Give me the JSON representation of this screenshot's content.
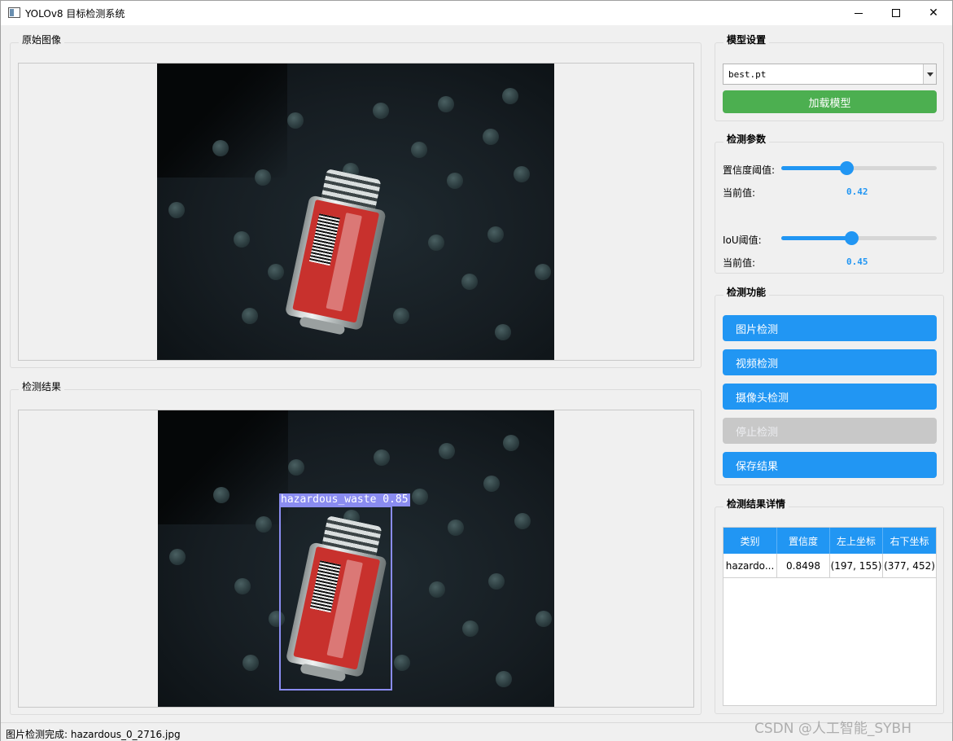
{
  "window": {
    "title": "YOLOv8 目标检测系统",
    "controls": [
      "minimize",
      "maximize",
      "close"
    ]
  },
  "original_panel": {
    "title": "原始图像"
  },
  "result_panel": {
    "title": "检测结果",
    "detection_label": "hazardous_waste 0.85"
  },
  "model_settings": {
    "title": "模型设置",
    "model_select_value": "best.pt",
    "load_button": "加载模型"
  },
  "detection_params": {
    "title": "检测参数",
    "confidence": {
      "label": "置信度阈值:",
      "current_label": "当前值:",
      "value": "0.42",
      "fraction": 0.42
    },
    "iou": {
      "label": "IoU阈值:",
      "current_label": "当前值:",
      "value": "0.45",
      "fraction": 0.45
    }
  },
  "detection_functions": {
    "title": "检测功能",
    "buttons": [
      {
        "label": "图片检测",
        "state": "enabled"
      },
      {
        "label": "视频检测",
        "state": "enabled"
      },
      {
        "label": "摄像头检测",
        "state": "enabled"
      },
      {
        "label": "停止检测",
        "state": "disabled"
      },
      {
        "label": "保存结果",
        "state": "enabled"
      }
    ]
  },
  "result_details": {
    "title": "检测结果详情",
    "columns": [
      "类别",
      "置信度",
      "左上坐标",
      "右下坐标"
    ],
    "rows": [
      [
        "hazardo...",
        "0.8498",
        "(197, 155)",
        "(377, 452)"
      ]
    ]
  },
  "status_bar": {
    "text": "图片检测完成: hazardous_0_2716.jpg"
  },
  "watermark": "CSDN @人工智能_SYBH",
  "colors": {
    "accent_blue": "#2196f3",
    "load_green": "#4caf50",
    "disabled_gray": "#c8c8c8",
    "detection_box": "#8a8cf0"
  }
}
